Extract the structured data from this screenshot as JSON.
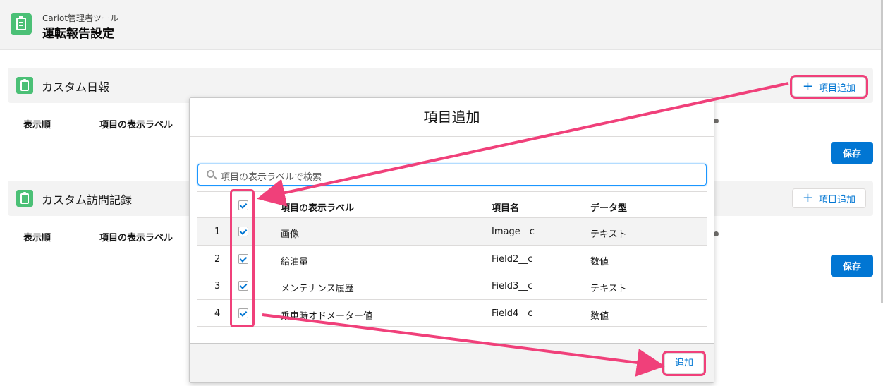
{
  "header": {
    "app_name": "Cariot管理者ツール",
    "page_title": "運転報告設定"
  },
  "sections": [
    {
      "title": "カスタム日報",
      "add_label": "項目追加",
      "col_order": "表示順",
      "col_label": "項目の表示ラベル",
      "save_label": "保存"
    },
    {
      "title": "カスタム訪問記録",
      "add_label": "項目追加",
      "col_order": "表示順",
      "col_label": "項目の表示ラベル",
      "save_label": "保存"
    }
  ],
  "modal": {
    "title": "項目追加",
    "search_placeholder": "項目の表示ラベルで検索",
    "columns": [
      "項目の表示ラベル",
      "項目名",
      "データ型"
    ],
    "rows": [
      {
        "num": "1",
        "label": "画像",
        "api": "Image__c",
        "type": "テキスト",
        "checked": true
      },
      {
        "num": "2",
        "label": "給油量",
        "api": "Field2__c",
        "type": "数値",
        "checked": true
      },
      {
        "num": "3",
        "label": "メンテナンス履歴",
        "api": "Field3__c",
        "type": "テキスト",
        "checked": true
      },
      {
        "num": "4",
        "label": "乗車時オドメーター値",
        "api": "Field4__c",
        "type": "数値",
        "checked": true
      }
    ],
    "add_button": "追加"
  },
  "colors": {
    "accent": "#0176d3",
    "highlight": "#f0407a",
    "icon_green": "#4bc076"
  }
}
